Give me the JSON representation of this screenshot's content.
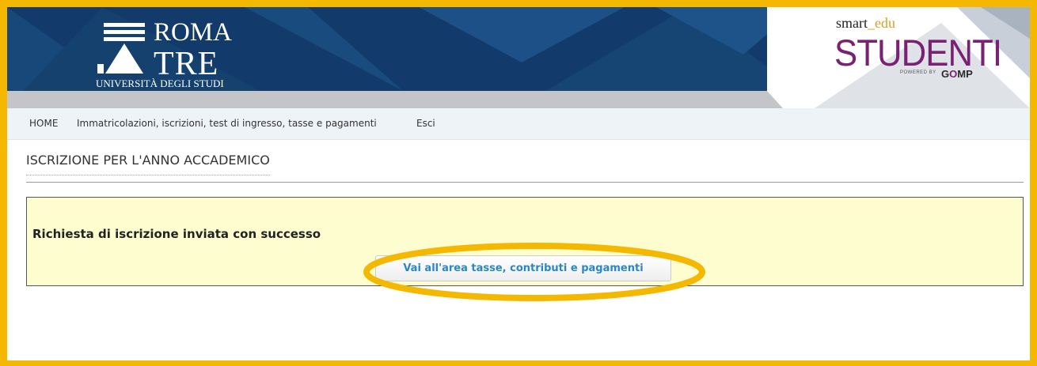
{
  "header": {
    "logo_left": {
      "line1": "ROMA",
      "line2": "TRE",
      "line3": "UNIVERSITÀ DEGLI STUDI"
    },
    "logo_right": {
      "smart": "smart",
      "underscore": "_",
      "edu": "edu",
      "brand": "STUDENTI",
      "powered_by": "POWERED BY",
      "gomp_g": "G",
      "gomp_o": "O",
      "gomp_mp": "MP"
    },
    "colors": {
      "banner_navy": "#123a6a",
      "brand_purple": "#7a2173",
      "frame_yellow": "#f5b800"
    }
  },
  "nav": {
    "items": [
      {
        "label": "HOME"
      },
      {
        "label": "Immatricolazioni, iscrizioni, test di ingresso, tasse e pagamenti"
      },
      {
        "label": "Esci"
      }
    ]
  },
  "main": {
    "page_title": "ISCRIZIONE PER L'ANNO ACCADEMICO",
    "message": "Richiesta di iscrizione inviata con successo",
    "action_button": "Vai all'area tasse, contributi e pagamenti"
  }
}
